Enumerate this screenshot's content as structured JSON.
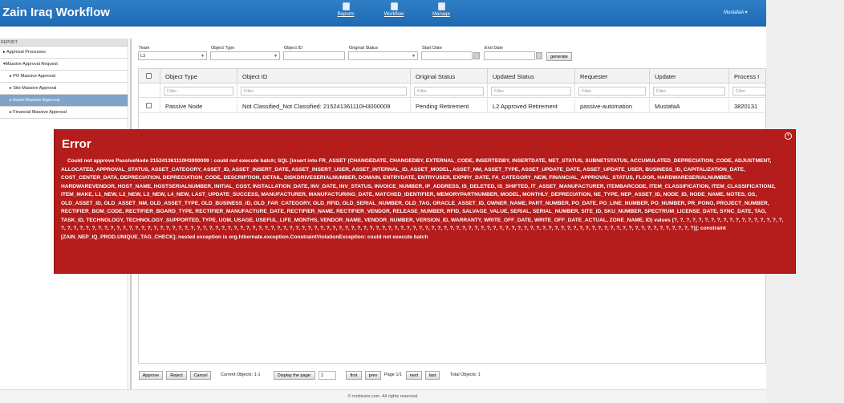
{
  "app": {
    "title": "Zain Iraq Workflow"
  },
  "nav": {
    "reports": "Reports",
    "workflow": "Workflow",
    "manage": "Manage",
    "user": "MustafaA ▾"
  },
  "sidebar": {
    "header": "REPORT",
    "items": [
      {
        "label": "▸ Approval Processes"
      },
      {
        "label": "▾Massive Approval Request"
      },
      {
        "label": "▸ PO Massive Approval"
      },
      {
        "label": "▸ Site Massive Approval"
      },
      {
        "label": "▸ Asset Massive Approval"
      },
      {
        "label": "▸ Financial Massive Approval"
      }
    ]
  },
  "filters": {
    "team_label": "Team",
    "team_value": "L3",
    "object_type_label": "Object Type",
    "object_type_value": "",
    "object_id_label": "Object ID",
    "object_id_value": "",
    "original_status_label": "Original Status",
    "original_status_value": "",
    "start_date_label": "Start Date",
    "start_date_value": "",
    "end_date_label": "End Date",
    "end_date_value": "",
    "generate": "generate"
  },
  "table": {
    "columns": [
      "Object Type",
      "Object ID",
      "Original Status",
      "Updated Status",
      "Requester",
      "Updater",
      "Process I"
    ],
    "filter_placeholder": "Filter",
    "rows": [
      [
        "Passive Node",
        "Not Classified_Not Classified: 215241361110H3000009",
        "Pending Retirement",
        "L2 Approved Retirement",
        "passive-automation",
        "MustafaA",
        "3820131"
      ]
    ]
  },
  "pager": {
    "approve": "Approve",
    "reject": "Reject",
    "cancel": "Cancel",
    "current_objects": "Current Objects: 1-1",
    "display_page": "Display the page:",
    "page_value": "1",
    "first": "first",
    "prev": "prev",
    "page_info": "Page 1/1",
    "next": "next",
    "last": "last",
    "total_objects": "Total Objects: 1"
  },
  "footer": "© mobinets.com. All rights reserved.",
  "error": {
    "title": "Error",
    "close": "×",
    "message": "Could not approve PassiveNode 215241361110H3000009 : could not execute batch; SQL [insert into FR_ASSET (CHANGEDATE, CHANGEDBY, EXTERNAL_CODE, INSERTEDBY, INSERTDATE, NET_STATUS, SUBNETSTATUS, ACCUMULATED_DEPRECIATION_CODE, ADJUSTMENT, ALLOCATED, APPROVAL_STATUS, ASSET_CATEGORY, ASSET_ID, ASSET_INSERT_DATE, ASSET_INSERT_USER, ASSET_INTERNAL_ID, ASSET_MODEL, ASSET_NM, ASSET_TYPE, ASSET_UPDATE_DATE, ASSET_UPDATE_USER, BUSINESS_ID, CAPITALIZATION_DATE, COST_CENTER_DATA, DEPRECIATION, DEPRECIATION_CODE, DESCRIPTION, DETAIL, DISKDRIVESERIALNUMBER, DOMAIN, ENTRYDATE, ENTRYUSER, EXPIRY_DATE, FA_CATEGORY_NEW, FINANCIAL_APPROVAL_STATUS, FLOOR, HARDWARESERIALNUMBER, HARDWAREVENDOR, HOST_NAME, HOSTSERIALNUMBER, INITIAL_COST, INSTALLATION_DATE, INV_DATE, INV_STATUS, INVOICE_NUMBER, IP_ADDRESS, IS_DELETED, IS_SHIFTED, IT_ASSET_MANUFACTURER, ITEMBARCODE, ITEM_CLASSIFICATION, ITEM_CLASSIFICATION2, ITEM_MAKE, L1_NEW, L2_NEW, L3_NEW, L4_NEW, LAST_UPDATE_SUCCESS, MANUFACTURER, MANUFACTURING_DATE, MATCHED_IDENTIFIER, MEMORYPARTNUMBER, MODEL, MONTHLY_DEPRECIATION, NE_TYPE, NEP_ASSET_ID, NODE_ID, NODE_NAME, NOTES, OS, OLD_ASSET_ID, OLD_ASSET_NM, OLD_ASSET_TYPE, OLD_BUSINESS_ID, OLD_FAR_CATEGORY, OLD_RFID, OLD_SERIAL_NUMBER, OLD_TAG, ORACLE_ASSET_ID, OWNER_NAME, PART_NUMBER, PO_DATE, PO_LINE_NUMBER, PO_NUMBER, PR_PONO, PROJECT_NUMBER, RECTIFIER_BOM_CODE, RECTIFIER_BOARD_TYPE, RECTIFIER_MANUFACTURE_DATE, RECTIFIER_NAME, RECTIFIER_VENDOR, RELEASE_NUMBER, RFID, SALVAGE_VALUE, SERIAL, SERIAL_NUMBER, SITE_ID, SKU_NUMBER, SPECTRUM_LICENSE_DATE, SYNC_DATE, TAG, TASK_ID, TECHNOLOGY, TECHNOLOGY_SUPPORTED, TYPE, UOM, USAGE, USEFUL_LIFE_MONTHS, VENDOR_NAME, VENDOR_NUMBER, VERSION_ID, WARRANTY, WRITE_OFF_DATE, WRITE_OFF_DATE_ACTUAL, ZONE_NAME, ID) values (?, ?, ?, ?, ?, ?, ?, ?, ?, ?, ?, ?, ?, ?, ?, ?, ?, ?, ?, ?, ?, ?, ?, ?, ?, ?, ?, ?, ?, ?, ?, ?, ?, ?, ?, ?, ?, ?, ?, ?, ?, ?, ?, ?, ?, ?, ?, ?, ?, ?, ?, ?, ?, ?, ?, ?, ?, ?, ?, ?, ?, ?, ?, ?, ?, ?, ?, ?, ?, ?, ?, ?, ?, ?, ?, ?, ?, ?, ?, ?, ?, ?, ?, ?, ?, ?, ?, ?, ?, ?, ?, ?, ?, ?, ?, ?, ?, ?, ?, ?, ?, ?, ?, ?, ?, ?, ?, ?, ?, ?, ?, ?, ?, ?, ?, ?, ?, ?, ?, ?, ?)]; constraint [ZAIN_NEP_IQ_PROD.UNIQUE_TAG_CHECK]; nested exception is org.hibernate.exception.ConstraintViolationException: could not execute batch"
  }
}
